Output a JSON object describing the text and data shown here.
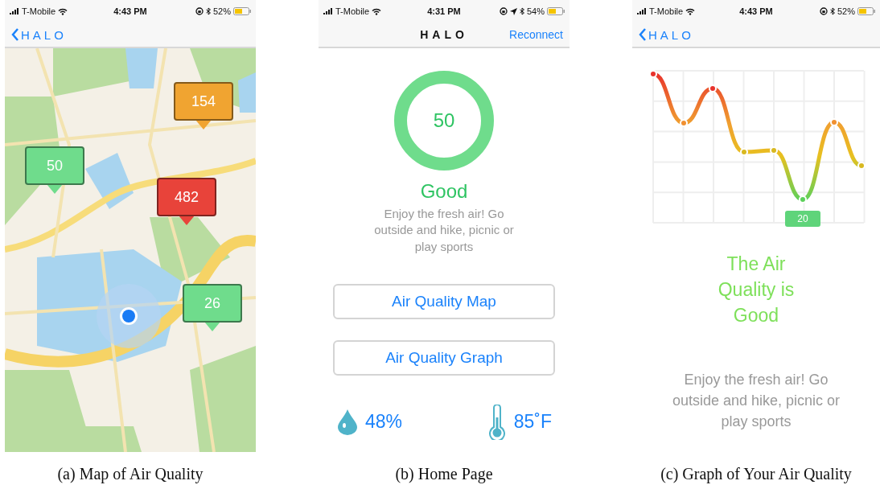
{
  "figures": [
    {
      "kind": "map",
      "status_bar": {
        "carrier": "T-Mobile",
        "time": "4:43 PM",
        "battery": "52%",
        "location_services": false
      },
      "nav": {
        "back": "HALO"
      },
      "markers": [
        {
          "value": "154",
          "color": "#f0a431"
        },
        {
          "value": "50",
          "color": "#6fdc8c"
        },
        {
          "value": "482",
          "color": "#e8433a"
        },
        {
          "value": "26",
          "color": "#6fdc8c"
        }
      ],
      "caption": "(a) Map of Air Quality"
    },
    {
      "kind": "home",
      "status_bar": {
        "carrier": "T-Mobile",
        "time": "4:31 PM",
        "battery": "54%",
        "location_services": true
      },
      "nav": {
        "title": "HALO",
        "action": "Reconnect"
      },
      "aqi": "50",
      "rating": "Good",
      "message": "Enjoy the fresh air! Go outside and hike, picnic or play sports",
      "buttons": [
        "Air Quality Map",
        "Air Quality Graph"
      ],
      "readings": [
        {
          "kind": "humidity",
          "value": "48%"
        },
        {
          "kind": "temperature",
          "value": "85˚F"
        }
      ],
      "caption": "(b) Home Page"
    },
    {
      "kind": "graph",
      "status_bar": {
        "carrier": "T-Mobile",
        "time": "4:43 PM",
        "battery": "52%",
        "location_services": false
      },
      "nav": {
        "back": "HALO"
      },
      "callout": "20",
      "heading": "The Air Quality is Good",
      "message": "Enjoy the fresh air! Go outside and hike, picnic or play sports",
      "caption": "(c) Graph of Your Air Quality"
    }
  ]
}
